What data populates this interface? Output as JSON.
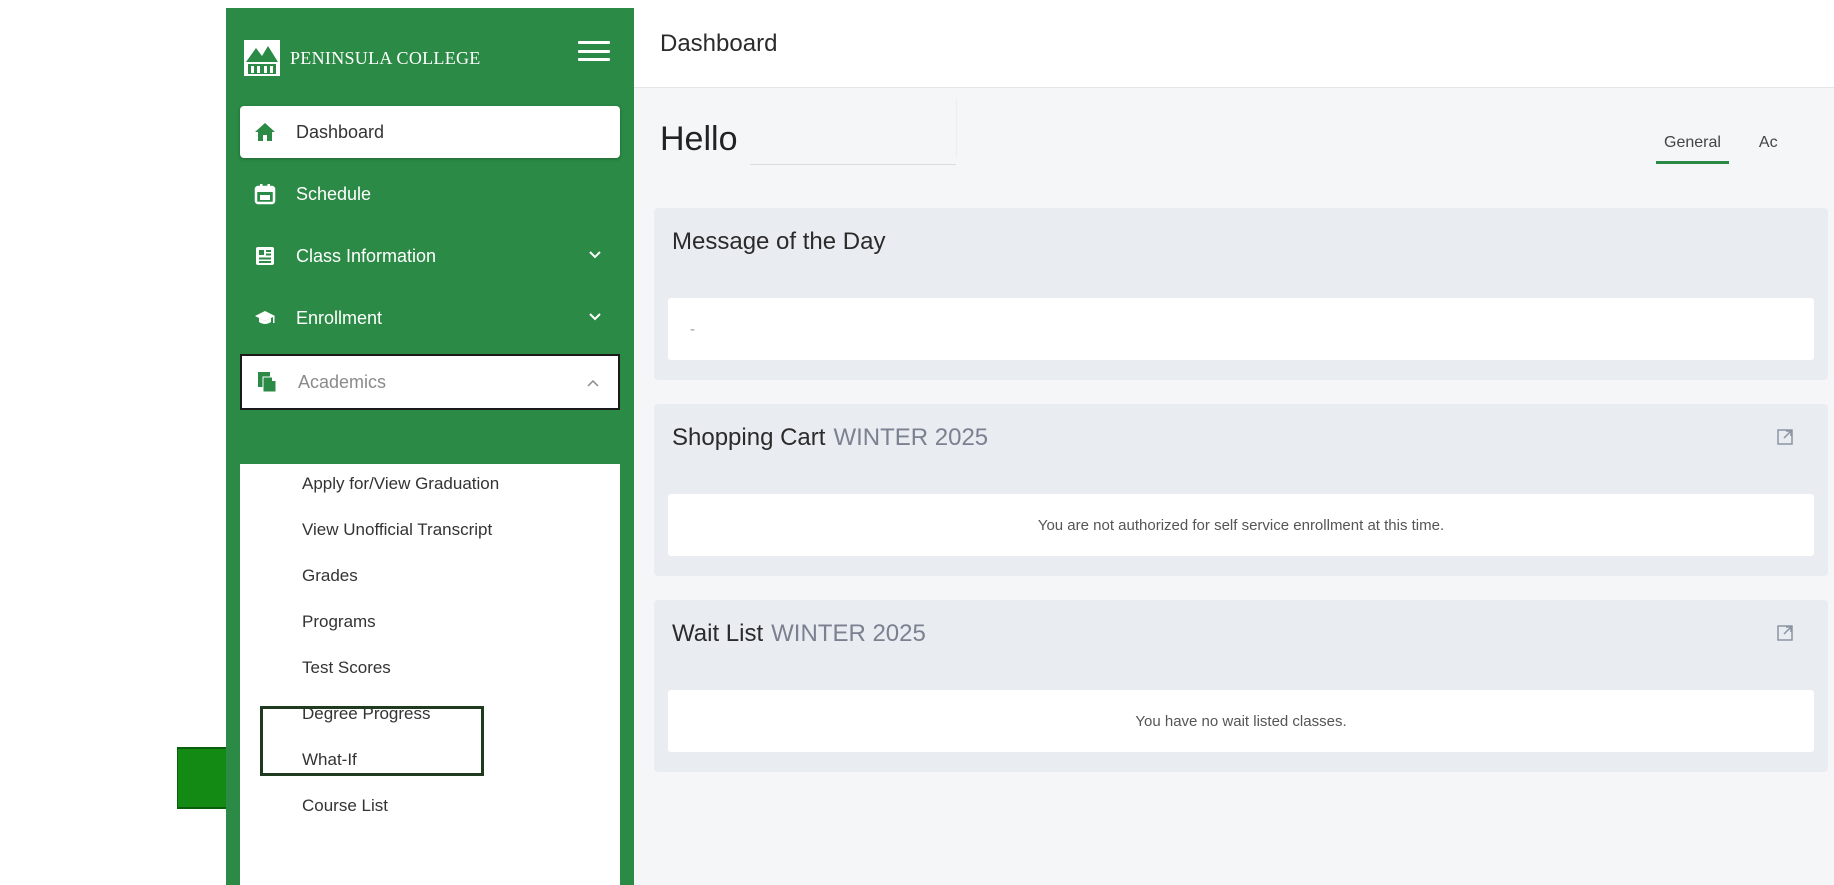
{
  "brand": {
    "name": "PENINSULA COLLEGE",
    "color": "#2b8a45"
  },
  "sidebar": {
    "items": [
      {
        "label": "Dashboard",
        "icon": "home-icon",
        "state": "active"
      },
      {
        "label": "Schedule",
        "icon": "calendar-icon"
      },
      {
        "label": "Class Information",
        "icon": "class-info-icon",
        "chevron": "chevron-down-icon"
      },
      {
        "label": "Enrollment",
        "icon": "graduation-cap-icon",
        "chevron": "chevron-down-icon"
      },
      {
        "label": "Academics",
        "icon": "documents-icon",
        "chevron": "chevron-up-icon",
        "state": "expanded"
      }
    ],
    "academics_submenu": [
      "Apply for/View Graduation",
      "View Unofficial Transcript",
      "Grades",
      "Programs",
      "Test Scores",
      "Degree Progress",
      "What-If",
      "Course List"
    ]
  },
  "header": {
    "title": "Dashboard"
  },
  "greeting": "Hello",
  "tabs": [
    {
      "label": "General",
      "active": true
    },
    {
      "label": "Ac"
    }
  ],
  "cards": {
    "message_of_day": {
      "title": "Message of the Day",
      "body": "-"
    },
    "shopping_cart": {
      "title": "Shopping Cart",
      "term": "WINTER 2025",
      "body": "You are not authorized for self service enrollment at this time."
    },
    "wait_list": {
      "title": "Wait List",
      "term": "WINTER 2025",
      "body": "You have no wait listed classes."
    }
  },
  "annotation": {
    "arrow_color": "#138a13",
    "highlighted_item": "Degree Progress"
  }
}
